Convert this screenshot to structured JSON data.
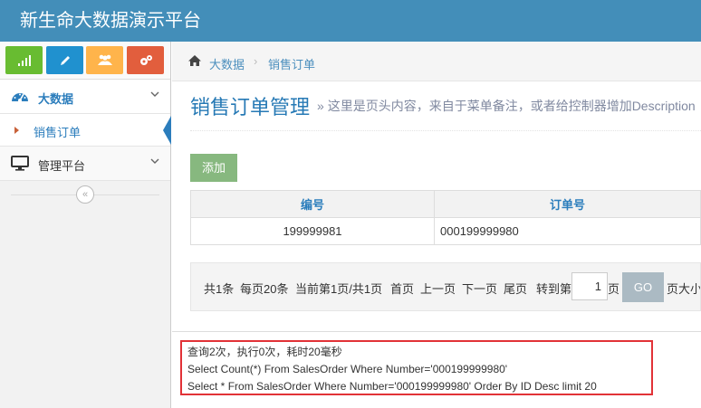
{
  "app": {
    "title": "新生命大数据演示平台"
  },
  "sidebar": {
    "shortcuts": [
      {
        "icon": "signal-icon",
        "color": "#68bc31"
      },
      {
        "icon": "pencil-icon",
        "color": "#2091cf"
      },
      {
        "icon": "users-icon",
        "color": "#ffb44b"
      },
      {
        "icon": "cogs-icon",
        "color": "#e25e3d"
      }
    ],
    "items": [
      {
        "label": "大数据",
        "icon": "dashboard-icon",
        "active": true
      },
      {
        "label": "管理平台",
        "icon": "desktop-icon",
        "active": false
      }
    ],
    "sub_items": [
      {
        "label": "销售订单",
        "active": true
      }
    ],
    "collapse_icon": "double-chevron-left-icon"
  },
  "breadcrumb": {
    "home_icon": "home-icon",
    "items": [
      "大数据",
      "销售订单"
    ]
  },
  "page_header": {
    "title": "销售订单管理",
    "description": "» 这里是页头内容，来自于菜单备注，或者给控制器增加Description"
  },
  "toolbar": {
    "add_label": "添加"
  },
  "table": {
    "columns": [
      "编号",
      "订单号"
    ],
    "rows": [
      [
        "199999981",
        "000199999980"
      ]
    ]
  },
  "pager": {
    "total": "共1条",
    "page_size": "每页20条",
    "current": "当前第1页/共1页",
    "first": "首页",
    "prev": "上一页",
    "next": "下一页",
    "last": "尾页",
    "goto_prefix": "转到第",
    "goto_value": "1",
    "goto_suffix": "页",
    "go_label": "GO",
    "size_label": "页大小"
  },
  "sql": {
    "stats": "查询2次，执行0次，耗时20毫秒",
    "lines": [
      "Select Count(*) From SalesOrder Where Number='000199999980'",
      "Select * From SalesOrder Where Number='000199999980' Order By ID Desc limit 20"
    ]
  },
  "colors": {
    "brand": "#438eb9",
    "highlight": "#e23237",
    "add_button": "#87b87f",
    "go_button": "#abbac3"
  }
}
